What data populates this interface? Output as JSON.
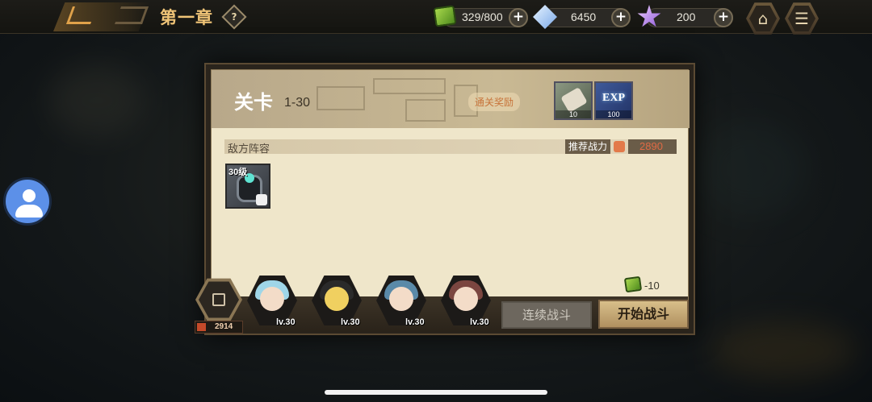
{
  "header": {
    "chapter_title": "第一章",
    "help_label": "?",
    "stamina": "329/800",
    "diamonds": "6450",
    "stars": "200",
    "plus_label": "+",
    "home_icon": "home-icon",
    "menu_icon": "menu-icon"
  },
  "stage": {
    "label": "关卡",
    "number": "1-30",
    "clear_reward_label": "通关奖励",
    "rewards": [
      {
        "icon": "scroll-icon",
        "count": "10"
      },
      {
        "icon": "exp-icon",
        "label": "EXP",
        "count": "100"
      }
    ]
  },
  "enemy": {
    "section_label": "敌方阵容",
    "recommended_power_label": "推荐战力",
    "recommended_power": "2890",
    "units": [
      {
        "level_label": "30级",
        "icon": "robot-enemy-icon"
      }
    ]
  },
  "cost": {
    "value": "-10",
    "icon": "stamina-icon"
  },
  "team": {
    "power": "2914",
    "heroes": [
      {
        "level": "lv.30",
        "hair": "#9fd6e8"
      },
      {
        "level": "lv.30",
        "hair": "#2a2a2a"
      },
      {
        "level": "lv.30",
        "hair": "#5a8aa8"
      },
      {
        "level": "lv.30",
        "hair": "#7b4640"
      }
    ]
  },
  "buttons": {
    "continuous_battle": "连续战斗",
    "start_battle": "开始战斗"
  }
}
